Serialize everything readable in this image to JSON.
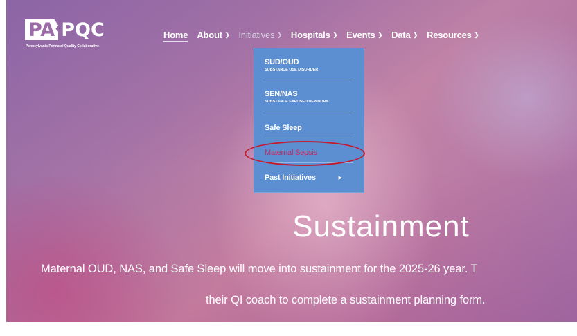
{
  "logo": {
    "main_pa": "PA",
    "main_pqc": "PQC",
    "subtitle": "Pennsylvania Perinatal Quality Collaborative"
  },
  "nav": {
    "items": [
      {
        "label": "Home"
      },
      {
        "label": "About"
      },
      {
        "label": "Initiatives"
      },
      {
        "label": "Hospitals"
      },
      {
        "label": "Events"
      },
      {
        "label": "Data"
      },
      {
        "label": "Resources"
      }
    ]
  },
  "initiatives_menu": {
    "items": [
      {
        "title": "SUD/OUD",
        "subtitle": "SUBSTANCE USE DISORDER"
      },
      {
        "title": "SEN/NAS",
        "subtitle": "SUBSTANCE EXPOSED NEWBORN"
      },
      {
        "title": "Safe Sleep"
      },
      {
        "title": "Maternal Sepsis"
      },
      {
        "title": "Past Initiatives"
      }
    ]
  },
  "hero": {
    "title": "Sustainment",
    "text_line1": "Maternal OUD, NAS, and Safe Sleep will move into sustainment for the 2025-26 year. T",
    "text_line2": "their QI coach to complete a sustainment planning form."
  },
  "colors": {
    "dropdown_bg": "#5b8fd2",
    "highlight_text": "#c3285c",
    "annotation_ellipse": "#c41a2c"
  }
}
